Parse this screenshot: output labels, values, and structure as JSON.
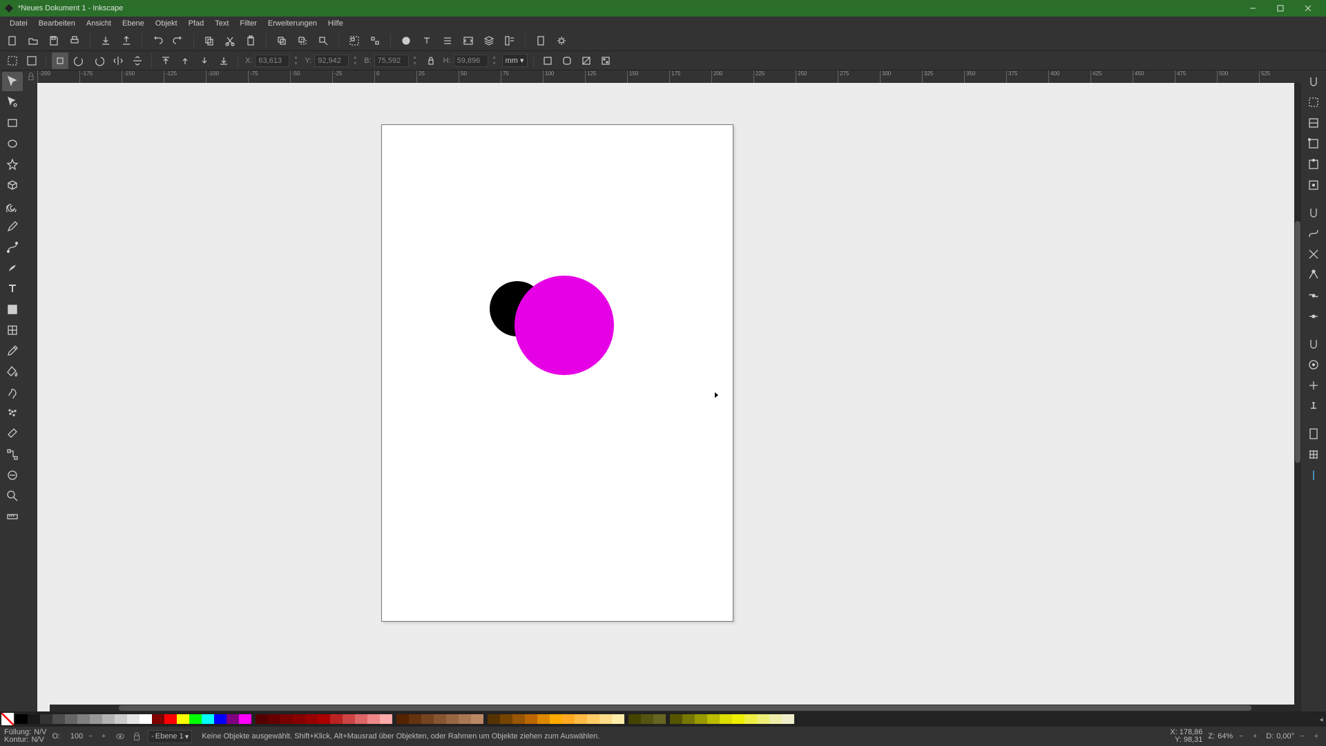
{
  "window": {
    "title": "*Neues Dokument 1 - Inkscape"
  },
  "menu": [
    "Datei",
    "Bearbeiten",
    "Ansicht",
    "Ebene",
    "Objekt",
    "Pfad",
    "Text",
    "Filter",
    "Erweiterungen",
    "Hilfe"
  ],
  "coords": {
    "x_label": "X:",
    "x": "63,613",
    "y_label": "Y:",
    "y": "92,942",
    "b_label": "B:",
    "b": "75,592",
    "h_label": "H:",
    "h": "59,896",
    "unit": "mm"
  },
  "ruler_h": [
    -200,
    -175,
    -150,
    -125,
    -100,
    -75,
    -50,
    -25,
    0,
    25,
    50,
    75,
    100,
    125,
    150,
    175,
    200,
    225,
    250,
    275,
    300,
    325,
    350,
    375,
    400,
    425,
    450,
    475,
    500,
    525
  ],
  "status": {
    "fill_label": "Füllung:",
    "stroke_label": "Kontur:",
    "fill": "N/V",
    "stroke": "N/V",
    "opacity_label": "O:",
    "opacity": "100",
    "layer_prefix": "-",
    "layer": "Ebene 1",
    "message": "Keine Objekte ausgewählt. Shift+Klick, Alt+Mausrad über Objekten, oder Rahmen um Objekte ziehen zum Auswählen.",
    "cx_label": "X:",
    "cx": "178,86",
    "cy_label": "Y:",
    "cy": "98,31",
    "zoom_label": "Z:",
    "zoom": "64%",
    "rot_label": "D:",
    "rot": "0,00°"
  },
  "palette_grays": [
    "#000000",
    "#1a1a1a",
    "#333333",
    "#4d4d4d",
    "#666666",
    "#808080",
    "#999999",
    "#b3b3b3",
    "#cccccc",
    "#e6e6e6",
    "#ffffff"
  ],
  "palette_basic": [
    "#800000",
    "#ff0000",
    "#ffff00",
    "#00ff00",
    "#00ffff",
    "#0000ff",
    "#800080",
    "#ff00ff"
  ],
  "palette_reds": [
    "#550000",
    "#660000",
    "#770000",
    "#880000",
    "#990000",
    "#aa0000",
    "#bb2222",
    "#cc4444",
    "#dd6666",
    "#ee8888",
    "#ffaaaa"
  ],
  "palette_browns": [
    "#552200",
    "#663311",
    "#774422",
    "#885533",
    "#996644",
    "#aa7755",
    "#bb8866"
  ],
  "palette_oranges": [
    "#553300",
    "#774400",
    "#995500",
    "#bb6600",
    "#dd8800",
    "#ffaa00",
    "#ffaa22",
    "#ffbb44",
    "#ffcc66",
    "#ffdd88",
    "#ffeeaa"
  ],
  "palette_yellows": [
    "#555500",
    "#777700",
    "#999900",
    "#bbbb00",
    "#dddd00",
    "#eeee00",
    "#eeee44",
    "#eeee77",
    "#eeeeaa",
    "#eeeecc"
  ],
  "palette_olives": [
    "#444400",
    "#555511",
    "#666622"
  ]
}
